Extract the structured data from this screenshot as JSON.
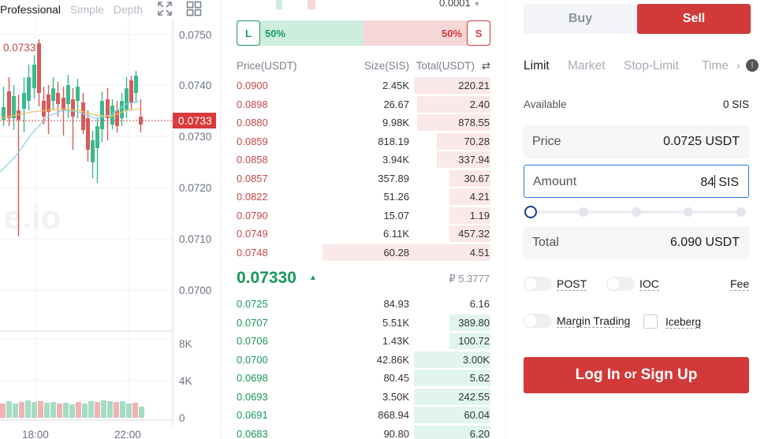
{
  "chart": {
    "tabs": [
      "Professional",
      "Simple",
      "Depth"
    ],
    "active_tab": "Professional",
    "price_axis": [
      "0.0750",
      "0.0740",
      "0.0730",
      "0.0720",
      "0.0710",
      "0.0700"
    ],
    "volume_axis": [
      "8K",
      "4K",
      "0"
    ],
    "time_axis": [
      "18:00",
      "22:00"
    ],
    "current_price_tag": "0.0733",
    "high_marker": "0.0733",
    "watermark": "e.io",
    "up_color": "#3cb98d",
    "down_color": "#d65b5b"
  },
  "orderbook": {
    "step_value": "0.0001",
    "long_label": "L",
    "long_pct": "50%",
    "short_label": "S",
    "short_pct": "50%",
    "headers": {
      "price": "Price(USDT)",
      "size": "Size(SIS)",
      "total": "Total(USDT)"
    },
    "asks": [
      {
        "price": "0.0900",
        "size": "2.45K",
        "total": "220.21",
        "depth": 0.3
      },
      {
        "price": "0.0898",
        "size": "26.67",
        "total": "2.40",
        "depth": 0.29
      },
      {
        "price": "0.0880",
        "size": "9.98K",
        "total": "878.55",
        "depth": 0.29
      },
      {
        "price": "0.0859",
        "size": "818.19",
        "total": "70.28",
        "depth": 0.21
      },
      {
        "price": "0.0858",
        "size": "3.94K",
        "total": "337.94",
        "depth": 0.21
      },
      {
        "price": "0.0857",
        "size": "357.89",
        "total": "30.67",
        "depth": 0.16
      },
      {
        "price": "0.0822",
        "size": "51.26",
        "total": "4.21",
        "depth": 0.16
      },
      {
        "price": "0.0790",
        "size": "15.07",
        "total": "1.19",
        "depth": 0.16
      },
      {
        "price": "0.0749",
        "size": "6.11K",
        "total": "457.32",
        "depth": 0.16
      },
      {
        "price": "0.0748",
        "size": "60.28",
        "total": "4.51",
        "depth": 0.66
      }
    ],
    "last_price": "0.07330",
    "last_price_fiat": "₽ 5.3777",
    "bids": [
      {
        "price": "0.0725",
        "size": "84.93",
        "total": "6.16",
        "depth": 0.0
      },
      {
        "price": "0.0707",
        "size": "5.51K",
        "total": "389.80",
        "depth": 0.16
      },
      {
        "price": "0.0706",
        "size": "1.43K",
        "total": "100.72",
        "depth": 0.16
      },
      {
        "price": "0.0700",
        "size": "42.86K",
        "total": "3.00K",
        "depth": 0.3
      },
      {
        "price": "0.0698",
        "size": "80.45",
        "total": "5.62",
        "depth": 0.3
      },
      {
        "price": "0.0693",
        "size": "3.50K",
        "total": "242.55",
        "depth": 0.3
      },
      {
        "price": "0.0691",
        "size": "868.94",
        "total": "60.04",
        "depth": 0.3
      },
      {
        "price": "0.0683",
        "size": "90.80",
        "total": "6.20",
        "depth": 0.3
      }
    ]
  },
  "trade": {
    "buy_label": "Buy",
    "sell_label": "Sell",
    "order_types": [
      "Limit",
      "Market",
      "Stop-Limit",
      "Time"
    ],
    "active_order_type": "Limit",
    "available_label": "Available",
    "available_value": "0 SIS",
    "price_label": "Price",
    "price_value": "0.0725 USDT",
    "amount_label": "Amount",
    "amount_value": "84",
    "amount_unit": "SIS",
    "total_label": "Total",
    "total_value": "6.090 USDT",
    "post_label": "POST",
    "ioc_label": "IOC",
    "fee_label": "Fee",
    "margin_label": "Margin Trading",
    "iceberg_label": "Iceberg",
    "login_label": "Log In",
    "or_label": "or",
    "signup_label": "Sign Up",
    "accent_color": "#d23a3a"
  }
}
